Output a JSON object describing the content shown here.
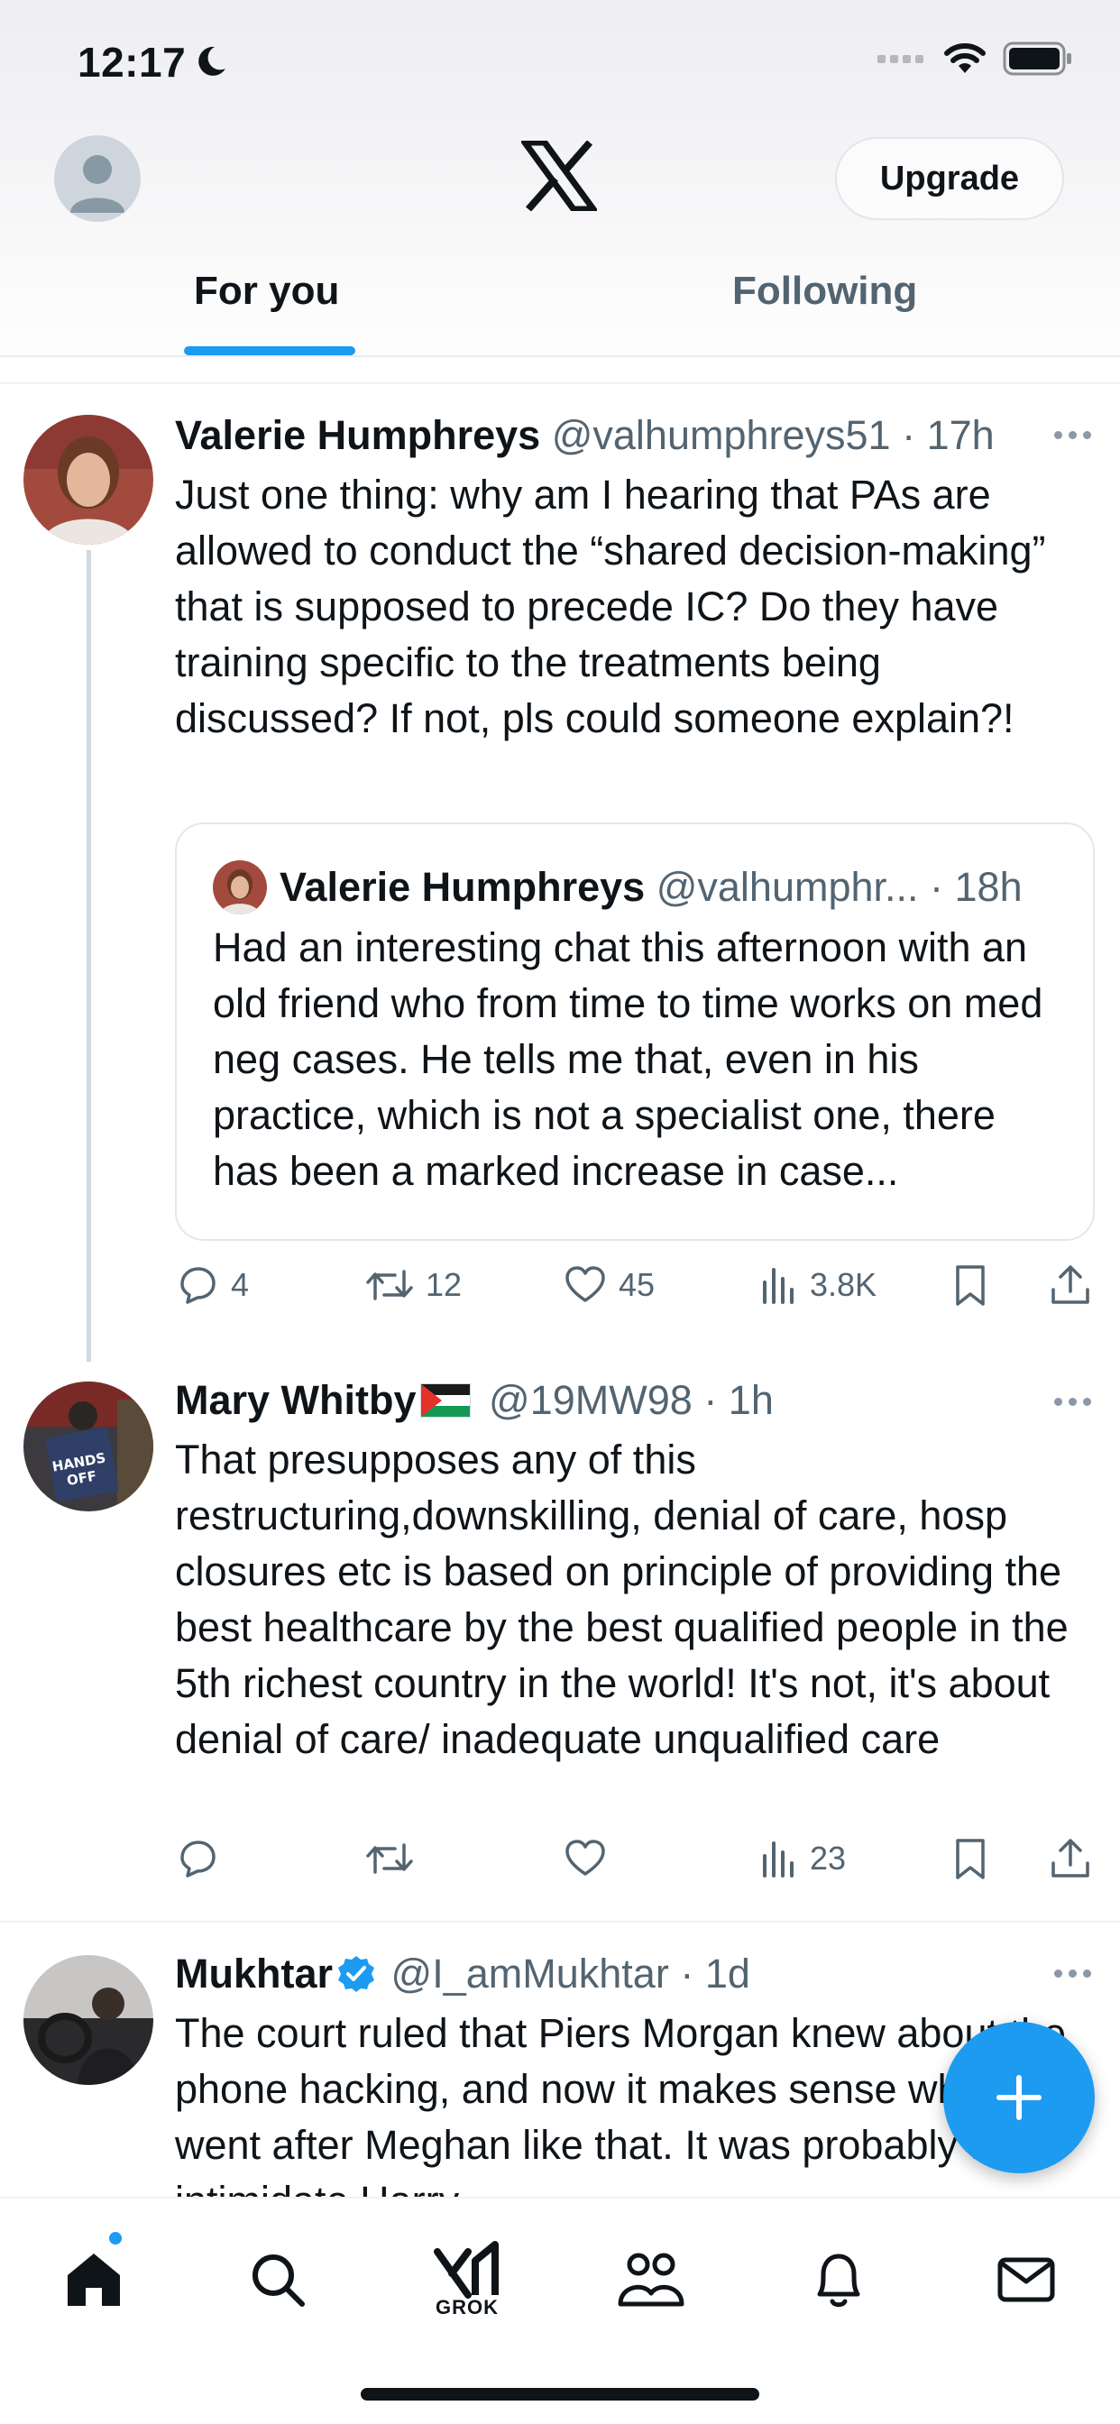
{
  "status_bar": {
    "time": "12:17"
  },
  "header": {
    "upgrade_label": "Upgrade"
  },
  "tabs": [
    {
      "label": "For you",
      "active": true
    },
    {
      "label": "Following",
      "active": false
    }
  ],
  "tweets": [
    {
      "name": "Valerie Humphreys",
      "handle": "@valhumphreys51",
      "time": "· 17h",
      "text": "Just one thing: why am I hearing that PAs are allowed to conduct the “shared decision-making” that is supposed to precede IC? Do they have training specific to the treatments being discussed? If not, pls could someone explain?!",
      "quote": {
        "name": "Valerie Humphreys",
        "handle": "@valhumphr...",
        "time": "· 18h",
        "text": "Had an interesting chat this afternoon with an old friend who from time to time works on med neg cases. He tells me that, even in his practice, which is not a specialist one, there has been a marked increase in case..."
      },
      "replies": "4",
      "reposts": "12",
      "likes": "45",
      "views": "3.8K"
    },
    {
      "name": "Mary Whitby",
      "handle": "@19MW98",
      "time": "· 1h",
      "text": "That presupposes any of this restructuring,downskilling, denial of care, hosp closures etc is based on principle of providing the best healthcare by the best qualified people in the 5th richest country in the world! It's not, it's about denial of care/ inadequate unqualified care",
      "replies": "",
      "reposts": "",
      "likes": "",
      "views": "23"
    },
    {
      "name": "Mukhtar",
      "handle": "@I_amMukhtar",
      "time": "· 1d",
      "text": "The court ruled that Piers Morgan knew about the phone hacking, and now it makes sense why he went after Meghan like that. It was probably to intimidate Harry"
    }
  ],
  "bottom_nav": {
    "grok_label": "GROK"
  },
  "colors": {
    "accent": "#1d9bf0",
    "secondary_text": "#536471",
    "primary_text": "#0f1419"
  }
}
